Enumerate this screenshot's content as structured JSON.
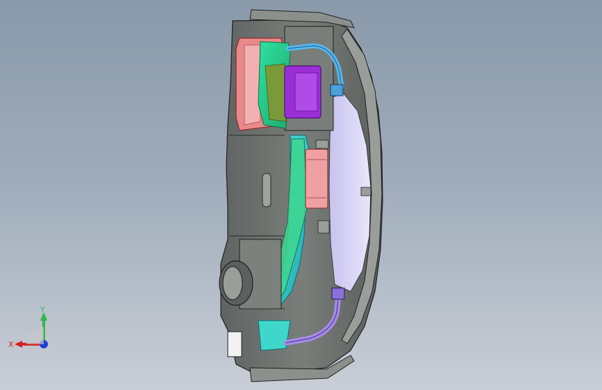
{
  "view": {
    "background_top": "#8a9aaa",
    "background_bottom": "#c9ced6"
  },
  "model": {
    "colors": {
      "housing": "#6b6f6d",
      "housing_light": "#8c908d",
      "housing_dark": "#3a3d3c",
      "red_part": "#e98a8a",
      "green_part": "#37d28a",
      "cyan_part": "#3fd6cc",
      "purple_part": "#9a2fd6",
      "blue_tube": "#58b8ec",
      "lavender_panel": "#d8d4f2",
      "violet_tube": "#a58ce6"
    }
  },
  "triad": {
    "y_label": "Y",
    "x_label": "X",
    "y_color": "#2fb84a",
    "x_color": "#d42020",
    "z_color": "#1f3fd0"
  }
}
